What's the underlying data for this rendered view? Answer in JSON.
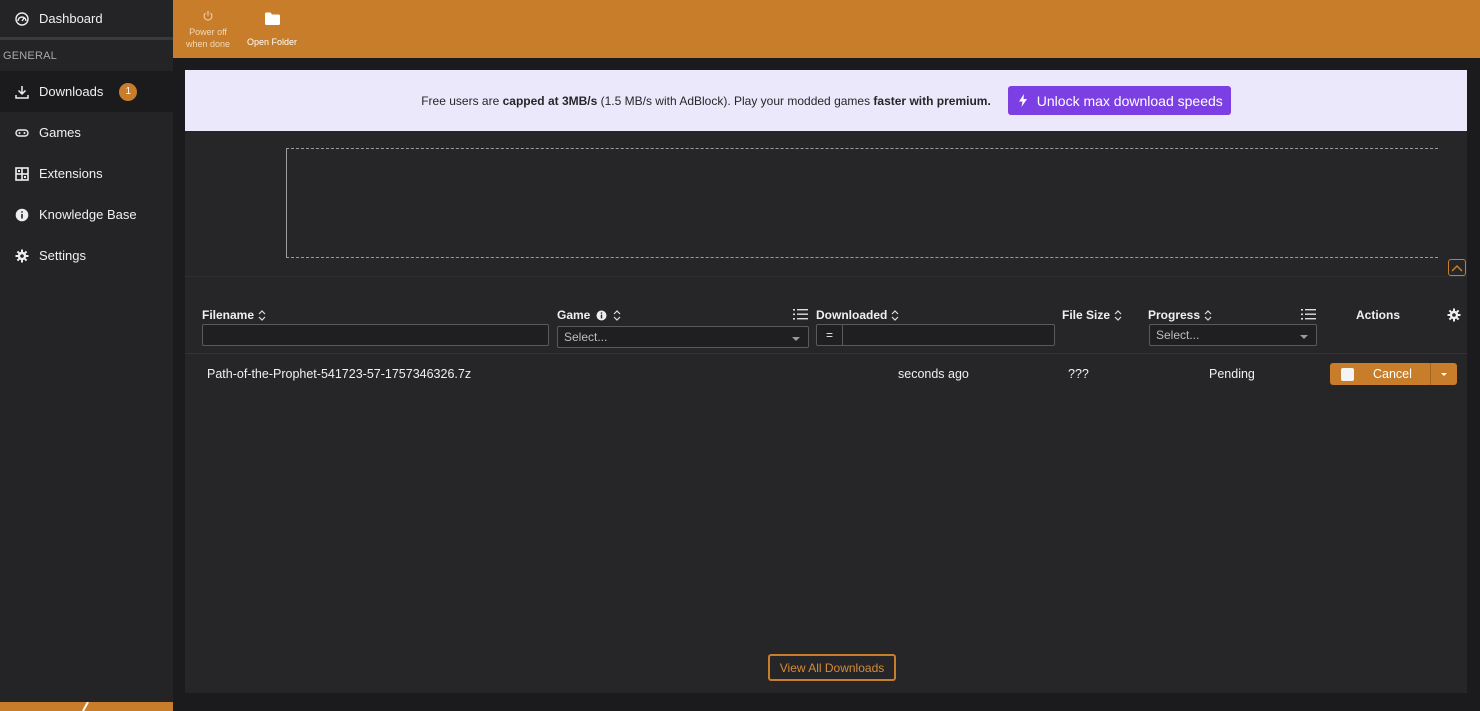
{
  "sidebar": {
    "dashboard": "Dashboard",
    "section_general": "GENERAL",
    "items": [
      {
        "label": "Downloads",
        "icon": "download-icon",
        "badge": "1"
      },
      {
        "label": "Games",
        "icon": "gamepad-icon"
      },
      {
        "label": "Extensions",
        "icon": "puzzle-icon"
      },
      {
        "label": "Knowledge Base",
        "icon": "info-icon"
      },
      {
        "label": "Settings",
        "icon": "gear-icon"
      }
    ]
  },
  "toolbar": {
    "power_off": "Power off when done",
    "power_off_line1": "Power off",
    "power_off_line2": "when done",
    "open_folder": "Open Folder"
  },
  "promo": {
    "text1": "Free users are ",
    "bold1": "capped at 3MB/s",
    "text2": " (1.5 MB/s with AdBlock). Play your modded games ",
    "bold2": "faster with premium.",
    "button": "Unlock max download speeds"
  },
  "table": {
    "columns": {
      "filename": "Filename",
      "game": "Game",
      "downloaded": "Downloaded",
      "file_size": "File Size",
      "progress": "Progress",
      "actions": "Actions"
    },
    "filters": {
      "game_placeholder": "Select...",
      "downloaded_operator": "=",
      "progress_placeholder": "Select..."
    },
    "rows": [
      {
        "filename": "Path-of-the-Prophet-541723-57-1757346326.7z",
        "game": "",
        "downloaded": "seconds ago",
        "file_size": "???",
        "progress": "Pending",
        "action": "Cancel"
      }
    ]
  },
  "footer": {
    "view_all": "View All Downloads"
  },
  "colors": {
    "accent": "#c87d2a",
    "premium": "#7b3fe4",
    "promo_bg": "#ece8fb"
  }
}
